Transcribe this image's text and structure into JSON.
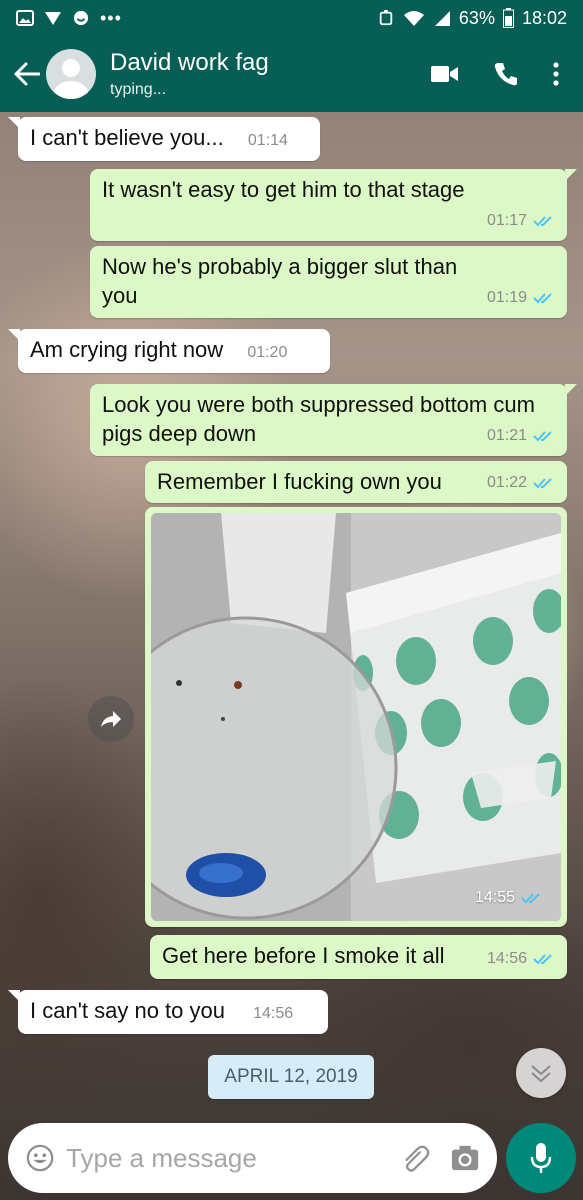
{
  "status_bar": {
    "battery": "63%",
    "time": "18:02",
    "left_icons": [
      "gallery-icon",
      "vpn-icon",
      "emoji-icon",
      "more-dots-icon"
    ],
    "right_icons": [
      "alarm-icon",
      "wifi-icon",
      "signal-icon",
      "battery-icon"
    ]
  },
  "header": {
    "contact_name": "David work fag",
    "contact_status": "typing..."
  },
  "messages": [
    {
      "dir": "in",
      "text": "I can't believe you...",
      "time": "01:14"
    },
    {
      "dir": "out",
      "text": "It wasn't easy to get him to that stage",
      "time": "01:17"
    },
    {
      "dir": "out",
      "text": "Now he's probably a bigger slut than you",
      "time": "01:19"
    },
    {
      "dir": "in",
      "text": "Am crying right now",
      "time": "01:20"
    },
    {
      "dir": "out",
      "text": "Look you were both suppressed bottom cum pigs deep down",
      "time": "01:21"
    },
    {
      "dir": "out",
      "text": "Remember I fucking own you",
      "time": "01:22"
    },
    {
      "dir": "out",
      "type": "image",
      "time": "14:55"
    },
    {
      "dir": "out",
      "text": "Get here before I smoke it all",
      "time": "14:56"
    },
    {
      "dir": "in",
      "text": "I can't say no to you",
      "time": "14:56"
    }
  ],
  "date_chip": "APRIL 12, 2019",
  "composer": {
    "placeholder": "Type a message"
  },
  "colors": {
    "header": "#075e54",
    "outgoing_bubble": "#dcf8c6",
    "incoming_bubble": "#ffffff",
    "read_ticks": "#4fc3f7",
    "mic_button": "#00897b"
  }
}
